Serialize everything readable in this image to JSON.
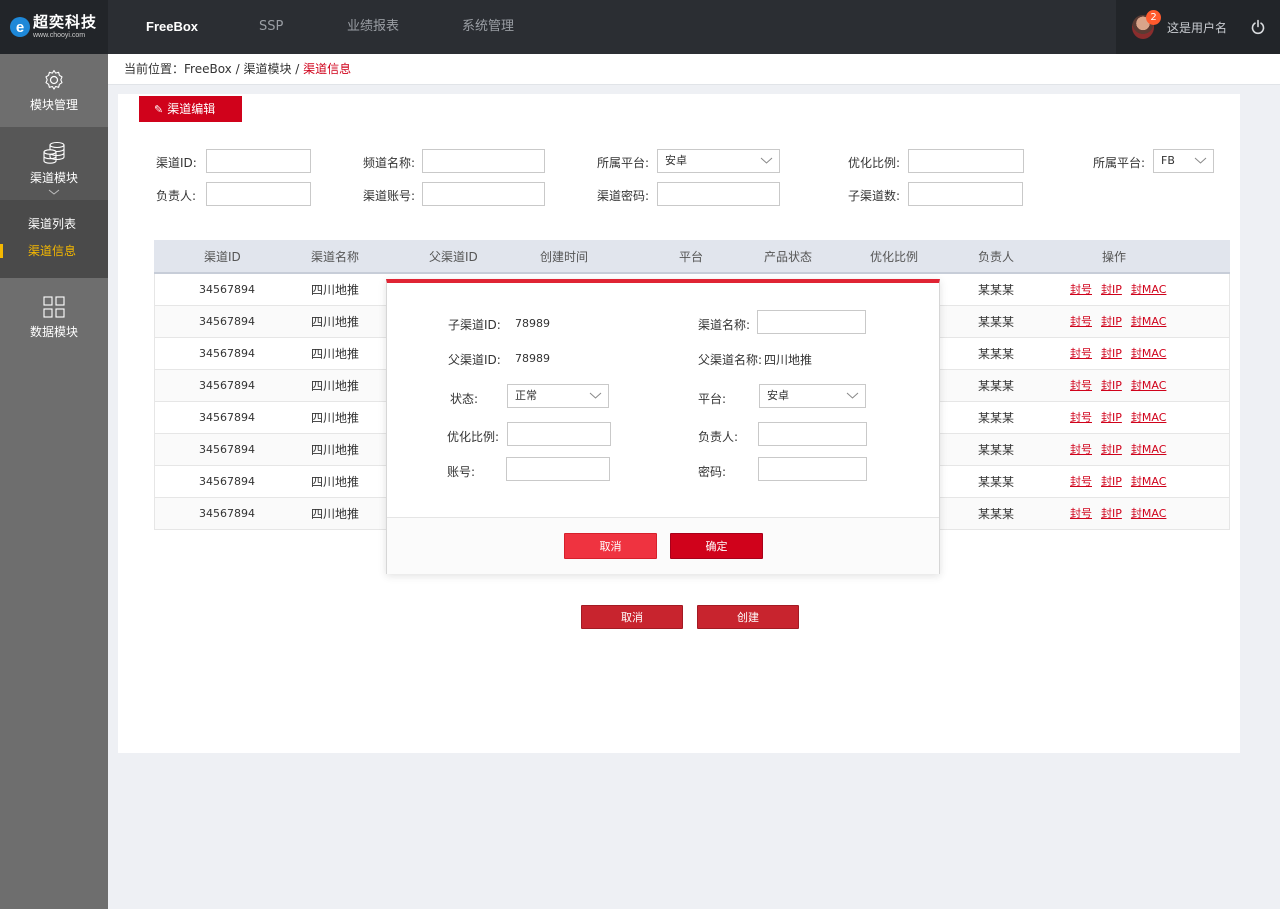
{
  "brand": {
    "name": "超奕科技",
    "url": "www.chooyi.com",
    "mark": "e"
  },
  "nav": {
    "items": [
      {
        "label": "FreeBox",
        "active": true
      },
      {
        "label": "SSP",
        "active": false
      },
      {
        "label": "业绩报表",
        "active": false
      },
      {
        "label": "系统管理",
        "active": false
      }
    ]
  },
  "user": {
    "name": "这是用户名",
    "notifications": "2"
  },
  "sidebar": {
    "module_mgmt": "模块管理",
    "channel_module": "渠道模块",
    "channel_list": "渠道列表",
    "channel_info": "渠道信息",
    "data_module": "数据模块"
  },
  "breadcrumb": {
    "prefix": "当前位置：",
    "root": "FreeBox",
    "sep": " / ",
    "module": "渠道模块",
    "current": "渠道信息"
  },
  "tab": {
    "label": "渠道编辑"
  },
  "filters": {
    "channel_id": {
      "label": "渠道ID:",
      "value": ""
    },
    "channel_name": {
      "label": "频道名称:",
      "value": ""
    },
    "platform": {
      "label": "所属平台:",
      "value": "安卓"
    },
    "ratio": {
      "label": "优化比例:",
      "value": ""
    },
    "platform2": {
      "label": "所属平台:",
      "value": "FB"
    },
    "owner": {
      "label": "负责人:",
      "value": ""
    },
    "account": {
      "label": "渠道账号:",
      "value": ""
    },
    "password": {
      "label": "渠道密码:",
      "value": ""
    },
    "sub_count": {
      "label": "子渠道数:",
      "value": ""
    }
  },
  "table": {
    "headers": [
      "渠道ID",
      "渠道名称",
      "父渠道ID",
      "创建时间",
      "平台",
      "产品状态",
      "优化比例",
      "负责人",
      "操作"
    ],
    "rows": [
      {
        "id": "34567894",
        "name": "四川地推",
        "owner": "某某某"
      },
      {
        "id": "34567894",
        "name": "四川地推",
        "owner": "某某某"
      },
      {
        "id": "34567894",
        "name": "四川地推",
        "owner": "某某某"
      },
      {
        "id": "34567894",
        "name": "四川地推",
        "owner": "某某某"
      },
      {
        "id": "34567894",
        "name": "四川地推",
        "owner": "某某某"
      },
      {
        "id": "34567894",
        "name": "四川地推",
        "owner": "某某某"
      },
      {
        "id": "34567894",
        "name": "四川地推",
        "owner": "某某某"
      },
      {
        "id": "34567894",
        "name": "四川地推",
        "owner": "某某某"
      }
    ],
    "ops": [
      "封号",
      "封IP",
      "封MAC"
    ]
  },
  "buttons": {
    "cancel": "取消",
    "create": "创建"
  },
  "modal": {
    "sub_id_label": "子渠道ID:",
    "sub_id_value": "78989",
    "name_label": "渠道名称:",
    "name_value": "",
    "parent_id_label": "父渠道ID:",
    "parent_id_value": "78989",
    "parent_name_label": "父渠道名称:",
    "parent_name_value": "四川地推",
    "status_label": "状态:",
    "status_value": "正常",
    "platform_label": "平台:",
    "platform_value": "安卓",
    "ratio_label": "优化比例:",
    "ratio_value": "",
    "owner_label": "负责人:",
    "owner_value": "",
    "account_label": "账号:",
    "account_value": "",
    "password_label": "密码:",
    "password_value": "",
    "cancel": "取消",
    "confirm": "确定"
  },
  "colors": {
    "accent": "#d0021b",
    "topbar": "#2b2e33",
    "sidebar": "#6e6e6e",
    "active_side": "#f5b800"
  },
  "icons": [
    "gear-icon",
    "database-icon",
    "chevron-down-icon",
    "grid-icon",
    "pencil-icon",
    "power-icon"
  ]
}
